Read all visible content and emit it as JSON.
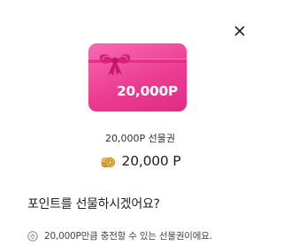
{
  "dialog": {
    "close_icon": "close-icon",
    "card": {
      "amount_label": "20,000P",
      "ribbon_icon": "gift-ribbon-icon",
      "gradient_from": "#f86bb4",
      "gradient_to": "#de2c86"
    },
    "product_name": "20,000P 선물권",
    "price": {
      "icon": "coin-stack-icon",
      "value": "20,000 P"
    },
    "question": "포인트를 선물하시겠어요?",
    "info": {
      "icon": "info-badge-icon",
      "text": "20,000P만큼 충전할 수 있는 선물권이에요."
    }
  }
}
